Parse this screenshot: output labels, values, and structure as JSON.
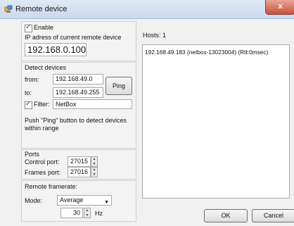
{
  "window": {
    "title": "Remote device",
    "close_label": "x"
  },
  "enable": {
    "label": "Enable",
    "checked": true
  },
  "current_device": {
    "label": "IP adress of current remote device",
    "value": "192.168.0.100"
  },
  "detect": {
    "title": "Detect devices",
    "from_label": "from:",
    "from_value": "192.168.49.0",
    "to_label": "to:",
    "to_value": "192.168.49.255",
    "ping_label": "Ping",
    "filter_label": "Filter:",
    "filter_checked": true,
    "filter_value": "NetBox",
    "hint": "Push \"Ping\" button to detect devices within range"
  },
  "ports": {
    "title": "Ports",
    "control_label": "Control port:",
    "control_value": "27015",
    "frames_label": "Frames port:",
    "frames_value": "27016"
  },
  "framerate": {
    "title": "Remote framerate:",
    "mode_label": "Mode:",
    "mode_value": "Average",
    "hz_value": "30",
    "hz_unit": "Hz"
  },
  "hosts": {
    "label": "Hosts:",
    "count": "1",
    "items": [
      "192.168.49.183 (netbox-13023004) (Rtt:0msec)"
    ]
  },
  "buttons": {
    "ok": "OK",
    "cancel": "Cancel"
  }
}
